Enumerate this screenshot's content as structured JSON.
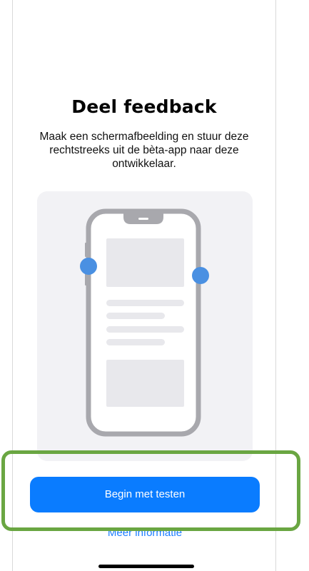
{
  "feedback": {
    "title": "Deel feedback",
    "description": "Maak een schermafbeelding en stuur deze rechtstreeks uit de bèta-app naar deze ontwikkelaar.",
    "illustration_icon": "phone-screenshot-illustration-icon"
  },
  "actions": {
    "primary_label": "Begin met testen",
    "secondary_label": "Meer informatie"
  },
  "colors": {
    "accent": "#0a7cff",
    "highlight": "#6aa642",
    "illustration_background": "#f2f2f5",
    "phone_frame": "#a8a8ad",
    "side_dots": "#4a90e2"
  }
}
